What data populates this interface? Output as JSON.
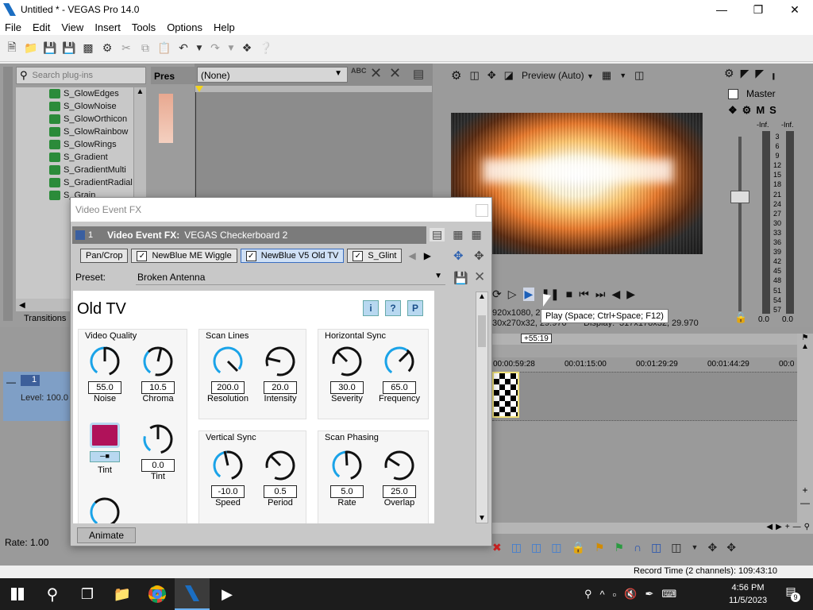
{
  "window": {
    "title": "Untitled * - VEGAS Pro 14.0"
  },
  "menu": [
    "File",
    "Edit",
    "View",
    "Insert",
    "Tools",
    "Options",
    "Help"
  ],
  "explorer": {
    "search_placeholder": "Search plug-ins",
    "tab_presets": "Pres",
    "tab_transitions": "Transitions",
    "plugins": [
      "S_GlowEdges",
      "S_GlowNoise",
      "S_GlowOrthicon",
      "S_GlowRainbow",
      "S_GlowRings",
      "S_Gradient",
      "S_GradientMulti",
      "S_GradientRadial",
      "S_Grain"
    ]
  },
  "trimmer": {
    "preset_value": "(None)"
  },
  "preview": {
    "mode": "Preview (Auto)",
    "info_line1": "920x1080, 2",
    "info_line2": "30x270x32, 29.970",
    "info_display": "Display:",
    "info_display_val": "317x178x32, 29.970",
    "tooltip": "Play (Space; Ctrl+Space; F12)"
  },
  "mixer": {
    "master_label": "Master",
    "inf_left": "-Inf.",
    "inf_right": "-Inf.",
    "scale": [
      "3",
      "6",
      "9",
      "12",
      "15",
      "18",
      "21",
      "24",
      "27",
      "30",
      "33",
      "36",
      "39",
      "42",
      "45",
      "48",
      "51",
      "54",
      "57"
    ],
    "db_left": "0.0",
    "db_right": "0.0"
  },
  "track": {
    "number": "1",
    "level": "Level: 100.0"
  },
  "timeline": {
    "marker": "+55:19",
    "times": [
      "00:00:59:28",
      "00:01:15:00",
      "00:01:29:29",
      "00:01:44:29",
      "00:0"
    ]
  },
  "status": {
    "rate": "Rate: 1.00",
    "record_time": "Record Time (2 channels): 109:43:10"
  },
  "fx_dialog": {
    "title": "Video Event FX",
    "chain_num": "1",
    "header_label": "Video Event FX:",
    "header_value": "VEGAS Checkerboard 2",
    "chain": {
      "pan_crop": "Pan/Crop",
      "wiggle": "NewBlue ME Wiggle",
      "oldtv": "NewBlue V5 Old TV",
      "glint": "S_Glint"
    },
    "preset_label": "Preset:",
    "preset_value": "Broken Antenna",
    "plugin_title": "Old TV",
    "btn_i": "i",
    "btn_q": "?",
    "btn_p": "P",
    "groups": {
      "video_quality": "Video Quality",
      "scan_lines": "Scan Lines",
      "horizontal_sync": "Horizontal Sync",
      "vertical_sync": "Vertical Sync",
      "scan_phasing": "Scan Phasing"
    },
    "params": {
      "noise": {
        "label": "Noise",
        "value": "55.0"
      },
      "chroma": {
        "label": "Chroma",
        "value": "10.5"
      },
      "resolution": {
        "label": "Resolution",
        "value": "200.0"
      },
      "intensity": {
        "label": "Intensity",
        "value": "20.0"
      },
      "severity": {
        "label": "Severity",
        "value": "30.0"
      },
      "frequency": {
        "label": "Frequency",
        "value": "65.0"
      },
      "tint_color": {
        "label": "Tint"
      },
      "tint": {
        "label": "Tint",
        "value": "0.0"
      },
      "speed": {
        "label": "Speed",
        "value": "-10.0"
      },
      "period": {
        "label": "Period",
        "value": "0.5"
      },
      "rate": {
        "label": "Rate",
        "value": "5.0"
      },
      "overlap": {
        "label": "Overlap",
        "value": "25.0"
      }
    },
    "animate": "Animate"
  },
  "taskbar": {
    "time": "4:56 PM",
    "date": "11/5/2023",
    "notif": "9"
  },
  "colors": {
    "accent_blue": "#1aa3e8",
    "tint_swatch": "#b0125a",
    "selected_chain": "#cfe0f5"
  }
}
